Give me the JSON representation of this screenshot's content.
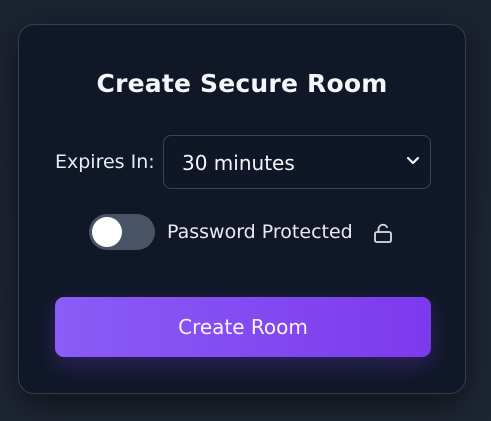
{
  "card": {
    "title": "Create Secure Room"
  },
  "expires": {
    "label": "Expires In:",
    "selected": "30 minutes"
  },
  "password_toggle": {
    "label": "Password Protected",
    "enabled": false
  },
  "create_button": {
    "label": "Create Room"
  },
  "icons": {
    "dropdown": "chevron-down-icon",
    "lock": "unlocked-icon"
  },
  "colors": {
    "accent": "#7c3aed",
    "card_background": "#101828",
    "toggle_off": "#485466"
  }
}
